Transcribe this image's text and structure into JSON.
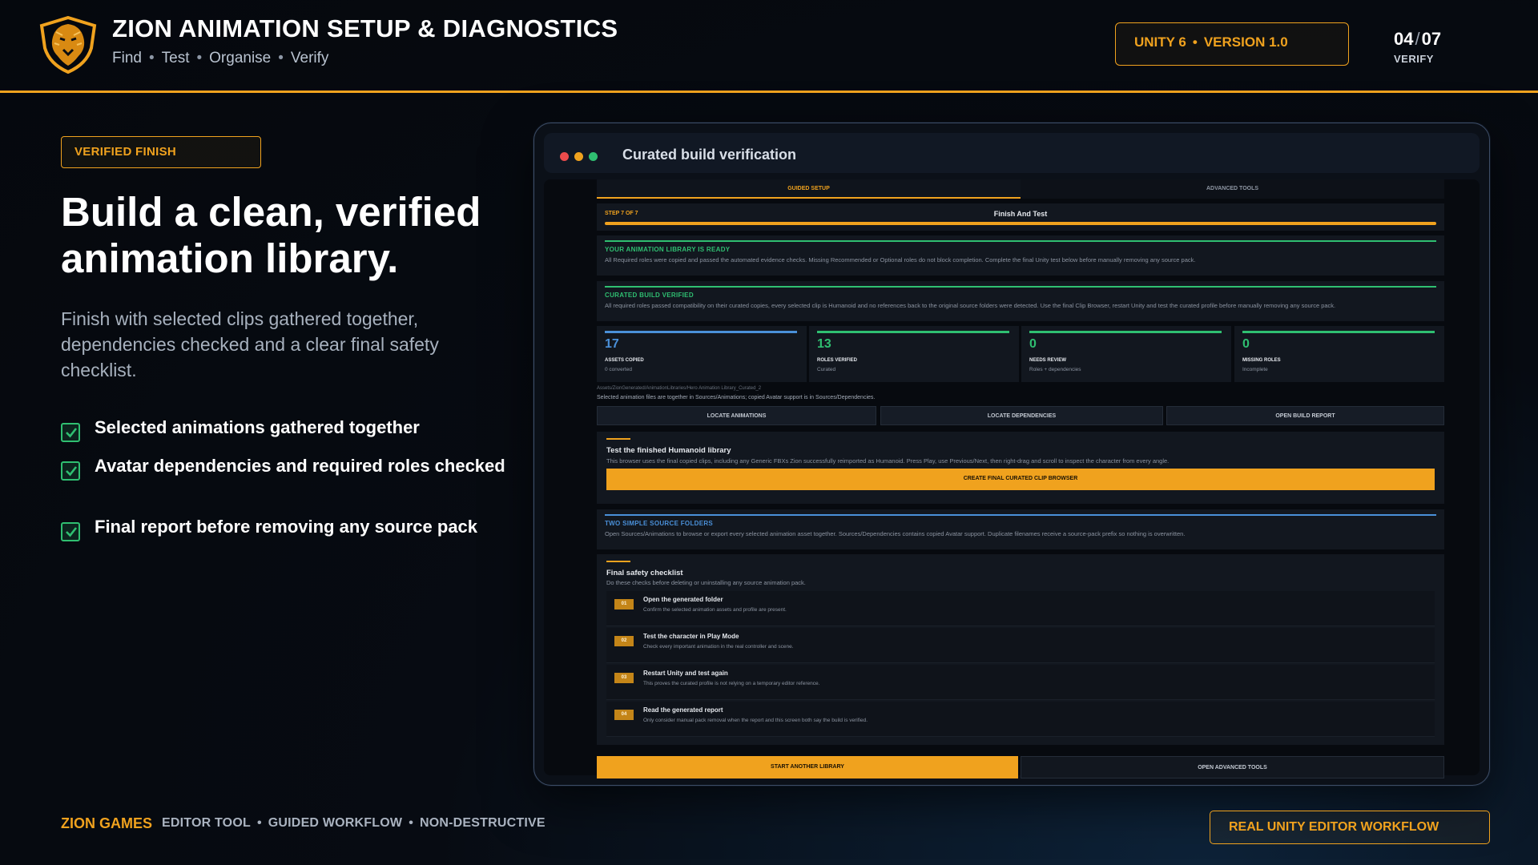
{
  "header": {
    "title": "ZION ANIMATION SETUP & DIAGNOSTICS",
    "subtitle_items": [
      "Find",
      "Test",
      "Organise",
      "Verify"
    ],
    "separator": "•",
    "version_unity": "UNITY 6",
    "version_dot": "•",
    "version_number": "VERSION 1.0",
    "page_current": "04",
    "page_slash": "/",
    "page_total": "07",
    "page_label": "VERIFY"
  },
  "left": {
    "tag": "VERIFIED FINISH",
    "headline": "Build a clean, verified animation library.",
    "lede": "Finish with selected clips gathered together, dependencies checked and a clear final safety checklist.",
    "checks": [
      "Selected animations gathered together",
      "Avatar dependencies and required roles checked",
      "Final report before removing any source pack"
    ]
  },
  "window": {
    "title": "Curated build verification",
    "tabs": [
      "GUIDED SETUP",
      "ADVANCED TOOLS"
    ],
    "step_label": "STEP 7 OF 7",
    "step_name": "Finish And Test",
    "ready_title": "YOUR ANIMATION LIBRARY IS READY",
    "ready_desc": "All Required roles were copied and passed the automated evidence checks. Missing Recommended or Optional roles do not block completion. Complete the final Unity test below before manually removing any source pack.",
    "verified_title": "CURATED BUILD VERIFIED",
    "verified_desc": "All required roles passed compatibility on their curated copies, every selected clip is Humanoid and no references back to the original source folders were detected. Use the final Clip Browser, restart Unity and test the curated profile before manually removing any source pack.",
    "stats": [
      {
        "value": "17",
        "label": "ASSETS COPIED",
        "sub": "0 converted"
      },
      {
        "value": "13",
        "label": "ROLES VERIFIED",
        "sub": "Curated"
      },
      {
        "value": "0",
        "label": "NEEDS REVIEW",
        "sub": "Roles + dependencies"
      },
      {
        "value": "0",
        "label": "MISSING ROLES",
        "sub": "Incomplete"
      }
    ],
    "path": "Assets/ZionGenerated/AnimationLibraries/Hero Animation Library_Curated_2",
    "path_note": "Selected animation files are together in Sources/Animations; copied Avatar support is in Sources/Dependencies.",
    "buttons": [
      "LOCATE ANIMATIONS",
      "LOCATE DEPENDENCIES",
      "OPEN BUILD REPORT"
    ],
    "test_title": "Test the finished Humanoid library",
    "test_desc": "This browser uses the final copied clips, including any Generic FBXs Zion successfully reimported as Humanoid. Press Play, use Previous/Next, then right-drag and scroll to inspect the character from every angle.",
    "create_button": "CREATE FINAL CURATED CLIP BROWSER",
    "folders_title": "TWO SIMPLE SOURCE FOLDERS",
    "folders_desc": "Open Sources/Animations to browse or export every selected animation asset together. Sources/Dependencies contains copied Avatar support. Duplicate filenames receive a source-pack prefix so nothing is overwritten.",
    "checklist_title": "Final safety checklist",
    "checklist_desc": "Do these checks before deleting or uninstalling any source animation pack.",
    "checklist": [
      {
        "num": "01",
        "title": "Open the generated folder",
        "desc": "Confirm the selected animation assets and profile are present."
      },
      {
        "num": "02",
        "title": "Test the character in Play Mode",
        "desc": "Check every important animation in the real controller and scene."
      },
      {
        "num": "03",
        "title": "Restart Unity and test again",
        "desc": "This proves the curated profile is not relying on a temporary editor reference."
      },
      {
        "num": "04",
        "title": "Read the generated report",
        "desc": "Only consider manual pack removal when the report and this screen both say the build is verified."
      }
    ],
    "bottom_primary": "START ANOTHER LIBRARY",
    "bottom_secondary": "OPEN ADVANCED TOOLS"
  },
  "footer": {
    "brand": "ZION GAMES",
    "tags": [
      "EDITOR TOOL",
      "GUIDED WORKFLOW",
      "NON-DESTRUCTIVE"
    ],
    "separator": "•",
    "real": "REAL UNITY EDITOR WORKFLOW"
  },
  "colors": {
    "accent": "#f0a21e",
    "success": "#2fbf71",
    "info": "#4a90d9",
    "background": "#05080d"
  },
  "icons": [
    "lion-logo-icon",
    "checkbox-checked-icon"
  ]
}
